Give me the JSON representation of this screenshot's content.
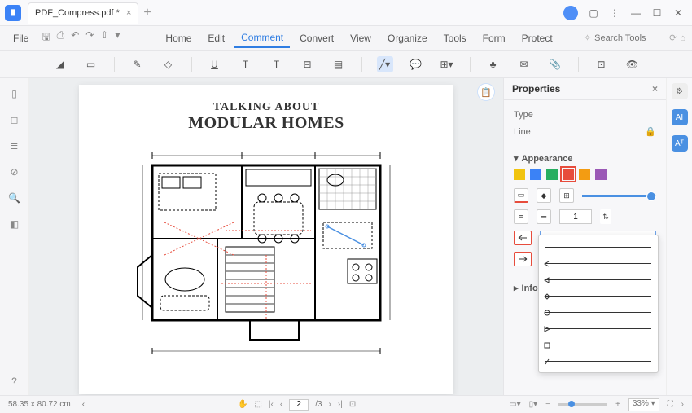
{
  "titlebar": {
    "tab_name": "PDF_Compress.pdf *"
  },
  "menus": {
    "file": "File",
    "items": [
      "Home",
      "Edit",
      "Comment",
      "Convert",
      "View",
      "Organize",
      "Tools",
      "Form",
      "Protect"
    ],
    "active_index": 2,
    "search_placeholder": "Search Tools"
  },
  "document": {
    "title_line1": "TALKING ABOUT",
    "title_line2": "MODULAR HOMES"
  },
  "properties": {
    "panel_title": "Properties",
    "type_label": "Type",
    "type_value": "Line",
    "appearance_label": "Appearance",
    "info_label": "Info",
    "thickness_value": "1",
    "swatches": [
      "#f1c40f",
      "#3b82f6",
      "#27ae60",
      "#e74c3c",
      "#f39c12",
      "#9b59b6"
    ],
    "selected_swatch_index": 3
  },
  "arrow_styles": [
    "none",
    "open-arrow",
    "closed-arrow",
    "diamond",
    "circle",
    "triangle",
    "square",
    "slash"
  ],
  "statusbar": {
    "dimensions": "58.35 x 80.72 cm",
    "page_current": "2",
    "page_total": "/3",
    "zoom_value": "33%"
  }
}
